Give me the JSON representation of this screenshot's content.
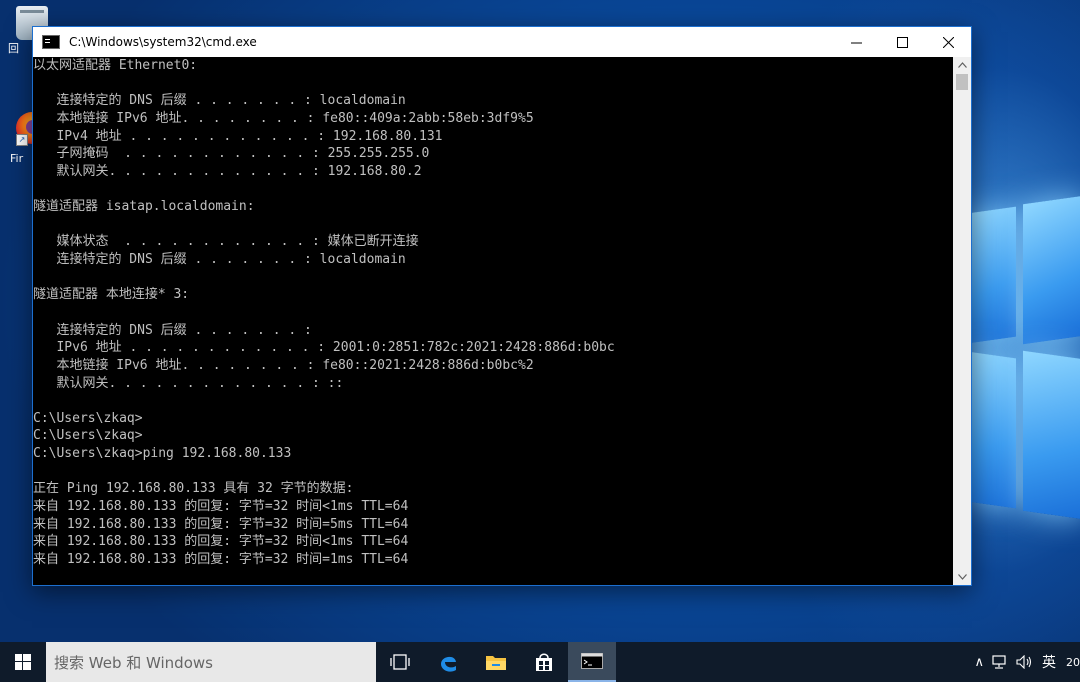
{
  "desktop": {
    "icons": [
      {
        "label": "回"
      },
      {
        "label": "Fir"
      }
    ]
  },
  "window": {
    "title": "C:\\Windows\\system32\\cmd.exe",
    "minimize_label": "—",
    "maximize_label": "☐",
    "close_label": "✕"
  },
  "console": {
    "lines": [
      "以太网适配器 Ethernet0:",
      "",
      "   连接特定的 DNS 后缀 . . . . . . . : localdomain",
      "   本地链接 IPv6 地址. . . . . . . . : fe80::409a:2abb:58eb:3df9%5",
      "   IPv4 地址 . . . . . . . . . . . . : 192.168.80.131",
      "   子网掩码  . . . . . . . . . . . . : 255.255.255.0",
      "   默认网关. . . . . . . . . . . . . : 192.168.80.2",
      "",
      "隧道适配器 isatap.localdomain:",
      "",
      "   媒体状态  . . . . . . . . . . . . : 媒体已断开连接",
      "   连接特定的 DNS 后缀 . . . . . . . : localdomain",
      "",
      "隧道适配器 本地连接* 3:",
      "",
      "   连接特定的 DNS 后缀 . . . . . . . :",
      "   IPv6 地址 . . . . . . . . . . . . : 2001:0:2851:782c:2021:2428:886d:b0bc",
      "   本地链接 IPv6 地址. . . . . . . . : fe80::2021:2428:886d:b0bc%2",
      "   默认网关. . . . . . . . . . . . . : ::",
      "",
      "C:\\Users\\zkaq>",
      "C:\\Users\\zkaq>",
      "C:\\Users\\zkaq>ping 192.168.80.133",
      "",
      "正在 Ping 192.168.80.133 具有 32 字节的数据:",
      "来自 192.168.80.133 的回复: 字节=32 时间<1ms TTL=64",
      "来自 192.168.80.133 的回复: 字节=32 时间=5ms TTL=64",
      "来自 192.168.80.133 的回复: 字节=32 时间<1ms TTL=64",
      "来自 192.168.80.133 的回复: 字节=32 时间=1ms TTL=64"
    ]
  },
  "taskbar": {
    "search_placeholder": "搜索 Web 和 Windows",
    "icons": [
      "task-view-icon",
      "edge-icon",
      "file-explorer-icon",
      "store-icon",
      "cmd-icon"
    ],
    "tray": {
      "chevron": "∧",
      "ime": "英",
      "clock_fragment": "20"
    }
  },
  "colors": {
    "console_bg": "#000000",
    "console_fg": "#c0c0c0",
    "taskbar_bg": "#0f1b2a",
    "window_border": "#1c6fcf"
  }
}
